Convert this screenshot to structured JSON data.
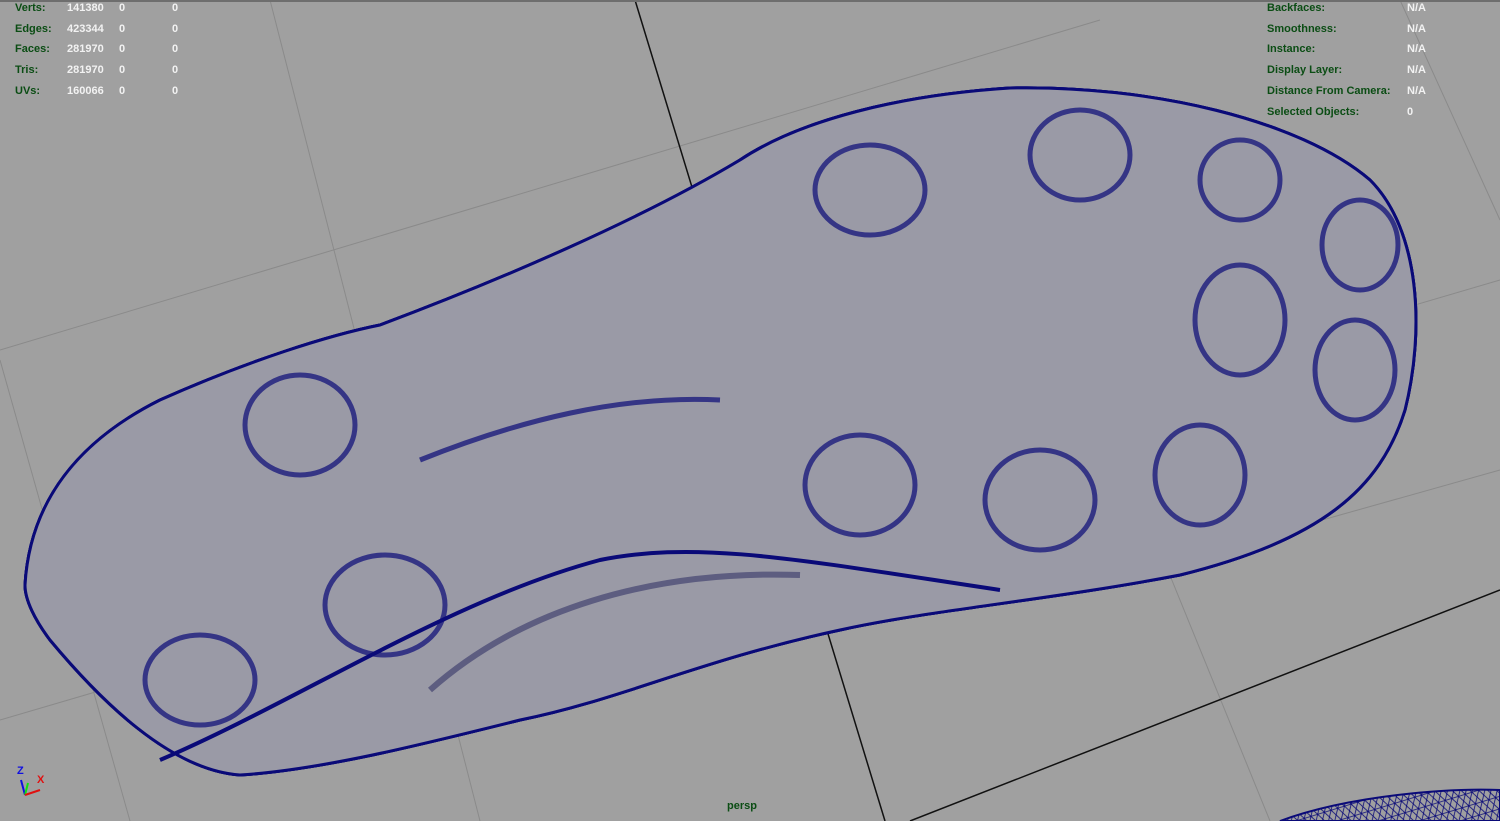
{
  "hud_left": [
    {
      "label": "Verts:",
      "values": [
        "141380",
        "0",
        "0"
      ]
    },
    {
      "label": "Edges:",
      "values": [
        "423344",
        "0",
        "0"
      ]
    },
    {
      "label": "Faces:",
      "values": [
        "281970",
        "0",
        "0"
      ]
    },
    {
      "label": "Tris:",
      "values": [
        "281970",
        "0",
        "0"
      ]
    },
    {
      "label": "UVs:",
      "values": [
        "160066",
        "0",
        "0"
      ]
    }
  ],
  "hud_right": [
    {
      "label": "Backfaces:",
      "value": "N/A"
    },
    {
      "label": "Smoothness:",
      "value": "N/A"
    },
    {
      "label": "Instance:",
      "value": "N/A"
    },
    {
      "label": "Display Layer:",
      "value": "N/A"
    },
    {
      "label": "Distance From Camera:",
      "value": "N/A"
    },
    {
      "label": "Selected Objects:",
      "value": "0"
    }
  ],
  "camera": "persp",
  "axis": {
    "z": "Z",
    "x": "X"
  },
  "colors": {
    "background": "#a0a0a0",
    "wireframe": "#0a0a78",
    "hud_label": "#0b4d14",
    "hud_value": "#f2f2f2"
  }
}
